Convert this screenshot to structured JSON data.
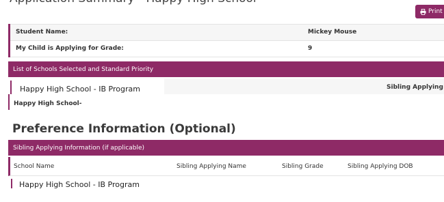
{
  "header": {
    "clipped_title": "Application Summary - Happy High School",
    "print_label": "Print"
  },
  "student": {
    "name_label": "Student Name:",
    "name_value": "Mickey Mouse",
    "grade_label": "My Child is Applying for Grade:",
    "grade_value": "9"
  },
  "schools": {
    "section_title": "List of Schools Selected and Standard Priority",
    "items": [
      {
        "name": "Happy High School - IB Program",
        "priority": "Sibling Applying",
        "sub": "Happy High School-"
      }
    ]
  },
  "preference": {
    "title": "Preference Information (Optional)",
    "section_title": "Sibling Applying Information (if applicable)",
    "columns": [
      "School Name",
      "Sibling Applying Name",
      "Sibling Grade",
      "Sibling Applying DOB"
    ],
    "rows": [
      {
        "school": "Happy High School - IB Program"
      }
    ]
  },
  "colors": {
    "accent": "#8e2a66"
  }
}
